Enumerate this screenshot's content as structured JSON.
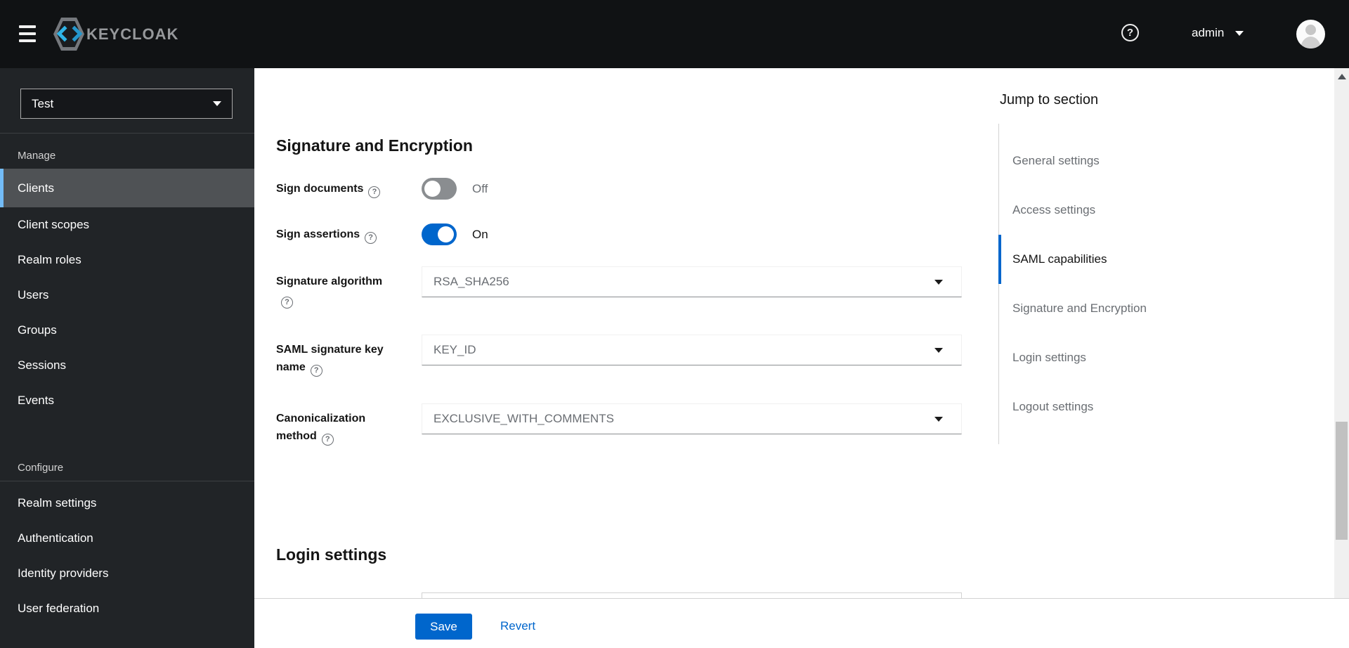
{
  "colors": {
    "primary": "#0066cc",
    "nav_active_indicator": "#73bcf7",
    "header_bg": "#101214",
    "sidebar_bg": "#212427",
    "sidebar_active_bg": "#4f5255",
    "muted_text": "#6a6e73"
  },
  "header": {
    "menu_icon": "hamburger-icon",
    "brand": "KEYCLOAK",
    "help_icon": "question-circle-icon",
    "user_label": "admin",
    "avatar_icon": "user-avatar-icon"
  },
  "sidebar": {
    "realm_selector": {
      "value": "Test",
      "icon": "chevron-down-icon"
    },
    "sections": [
      {
        "title": "Manage",
        "active_item": "Clients",
        "items": [
          "Clients",
          "Client scopes",
          "Realm roles",
          "Users",
          "Groups",
          "Sessions",
          "Events"
        ]
      },
      {
        "title": "Configure",
        "active_item": null,
        "items": [
          "Realm settings",
          "Authentication",
          "Identity providers",
          "User federation"
        ]
      }
    ]
  },
  "main": {
    "section_title": "Signature and Encryption",
    "fields": [
      {
        "label": "Sign documents",
        "type": "switch",
        "on": false,
        "state_label": "Off"
      },
      {
        "label": "Sign assertions",
        "type": "switch",
        "on": true,
        "state_label": "On"
      },
      {
        "label": "Signature algorithm",
        "type": "select",
        "value": "RSA_SHA256"
      },
      {
        "label": "SAML signature key name",
        "type": "select",
        "value": "KEY_ID"
      },
      {
        "label": "Canonicalization method",
        "type": "select",
        "value": "EXCLUSIVE_WITH_COMMENTS"
      }
    ],
    "next_section_title": "Login settings",
    "actions": {
      "save_label": "Save",
      "revert_label": "Revert"
    }
  },
  "jump_panel": {
    "title": "Jump to section",
    "items": [
      {
        "label": "General settings",
        "active": false
      },
      {
        "label": "Access settings",
        "active": false
      },
      {
        "label": "SAML capabilities",
        "active": true
      },
      {
        "label": "Signature and Encryption",
        "active": false
      },
      {
        "label": "Login settings",
        "active": false
      },
      {
        "label": "Logout settings",
        "active": false
      }
    ]
  }
}
